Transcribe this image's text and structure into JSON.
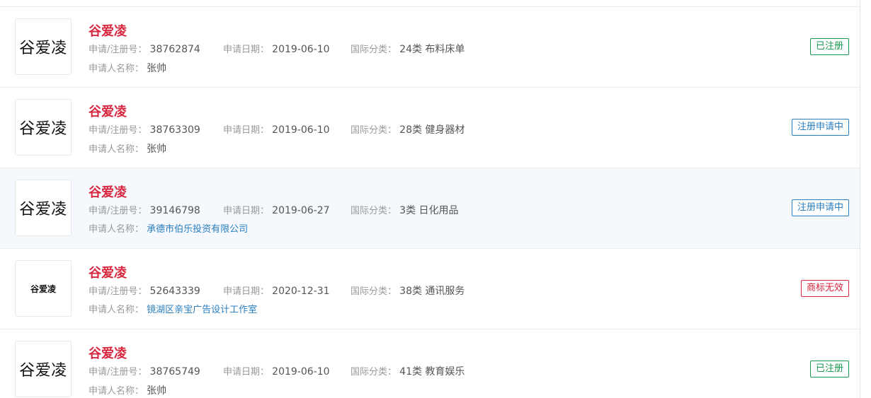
{
  "labels": {
    "app_no": "申请/注册号：",
    "app_date": "申请日期：",
    "intl_class": "国际分类：",
    "applicant": "申请人名称："
  },
  "colors": {
    "title": "#d7263d",
    "status_registered": "#1a9a52",
    "status_pending": "#2a7fc0",
    "status_invalid": "#d7263d",
    "link": "#2a7fc0"
  },
  "rows": [
    {
      "logo_text": "谷爱凌",
      "title": "谷爱凌",
      "app_no": "38762874",
      "app_date": "2019-06-10",
      "intl_class": "24类 布料床单",
      "applicant": "张帅",
      "applicant_link": false,
      "status": "已注册",
      "status_color": "#1a9a52",
      "highlight": false
    },
    {
      "logo_text": "谷爱凌",
      "title": "谷爱凌",
      "app_no": "38763309",
      "app_date": "2019-06-10",
      "intl_class": "28类 健身器材",
      "applicant": "张帅",
      "applicant_link": false,
      "status": "注册申请中",
      "status_color": "#2a7fc0",
      "highlight": false
    },
    {
      "logo_text": "谷爱凌",
      "title": "谷爱凌",
      "app_no": "39146798",
      "app_date": "2019-06-27",
      "intl_class": "3类 日化用品",
      "applicant": "承德市伯乐投资有限公司",
      "applicant_link": true,
      "status": "注册申请中",
      "status_color": "#2a7fc0",
      "highlight": true
    },
    {
      "logo_text": "谷爱凌",
      "logo_small": true,
      "title": "谷爱凌",
      "app_no": "52643339",
      "app_date": "2020-12-31",
      "intl_class": "38类 通讯服务",
      "applicant": "镜湖区亲宝广告设计工作室",
      "applicant_link": true,
      "status": "商标无效",
      "status_color": "#d7263d",
      "highlight": false
    },
    {
      "logo_text": "谷爱凌",
      "title": "谷爱凌",
      "app_no": "38765749",
      "app_date": "2019-06-10",
      "intl_class": "41类 教育娱乐",
      "applicant": "张帅",
      "applicant_link": false,
      "status": "已注册",
      "status_color": "#1a9a52",
      "highlight": false
    }
  ]
}
